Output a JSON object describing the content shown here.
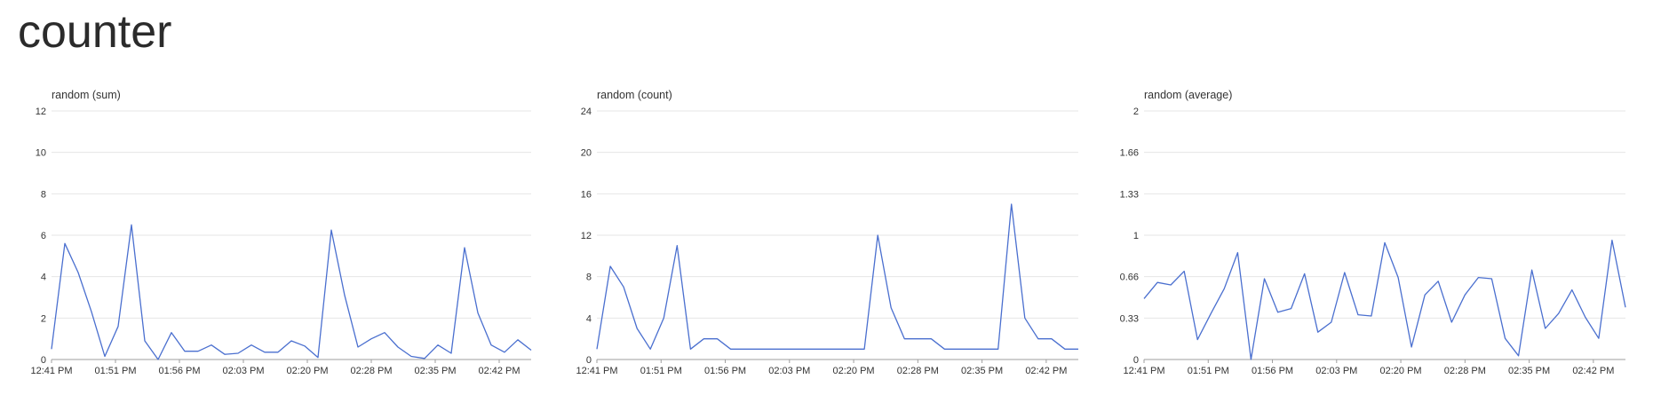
{
  "page": {
    "title": "counter"
  },
  "chart_data": [
    {
      "type": "line",
      "title": "random (sum)",
      "ylim": [
        0,
        12
      ],
      "yticks": [
        "0",
        "2",
        "4",
        "6",
        "8",
        "10",
        "12"
      ],
      "xticks": [
        "12:41 PM",
        "01:51 PM",
        "01:56 PM",
        "02:03 PM",
        "02:20 PM",
        "02:28 PM",
        "02:35 PM",
        "02:42 PM"
      ],
      "color": "#4a6fcf",
      "grid": true,
      "series": [
        {
          "values": [
            0.5,
            5.6,
            4.2,
            2.3,
            0.15,
            1.6,
            6.5,
            0.9,
            0.0,
            1.3,
            0.4,
            0.4,
            0.7,
            0.25,
            0.3,
            0.7,
            0.35,
            0.35,
            0.9,
            0.65,
            0.1,
            6.25,
            3.1,
            0.6,
            1.0,
            1.3,
            0.6,
            0.15,
            0.05,
            0.7,
            0.3,
            5.4,
            2.25,
            0.7,
            0.35,
            0.95,
            0.45
          ]
        }
      ]
    },
    {
      "type": "line",
      "title": "random (count)",
      "ylim": [
        0,
        24
      ],
      "yticks": [
        "0",
        "4",
        "8",
        "12",
        "16",
        "20",
        "24"
      ],
      "xticks": [
        "12:41 PM",
        "01:51 PM",
        "01:56 PM",
        "02:03 PM",
        "02:20 PM",
        "02:28 PM",
        "02:35 PM",
        "02:42 PM"
      ],
      "color": "#4a6fcf",
      "grid": true,
      "series": [
        {
          "values": [
            1,
            9,
            7,
            3,
            1,
            4,
            11,
            1,
            2,
            2,
            1,
            1,
            1,
            1,
            1,
            1,
            1,
            1,
            1,
            1,
            1,
            12,
            5,
            2,
            2,
            2,
            1,
            1,
            1,
            1,
            1,
            15,
            4,
            2,
            2,
            1,
            1
          ]
        }
      ]
    },
    {
      "type": "line",
      "title": "random (average)",
      "ylim": [
        0,
        2
      ],
      "yticks": [
        "0",
        "0.33",
        "0.66",
        "1",
        "1.33",
        "1.66",
        "2"
      ],
      "xticks": [
        "12:41 PM",
        "01:51 PM",
        "01:56 PM",
        "02:03 PM",
        "02:20 PM",
        "02:28 PM",
        "02:35 PM",
        "02:42 PM"
      ],
      "color": "#4a6fcf",
      "grid": true,
      "series": [
        {
          "values": [
            0.49,
            0.62,
            0.6,
            0.71,
            0.16,
            0.37,
            0.57,
            0.86,
            0.0,
            0.65,
            0.38,
            0.41,
            0.69,
            0.22,
            0.3,
            0.7,
            0.36,
            0.35,
            0.94,
            0.66,
            0.1,
            0.52,
            0.63,
            0.3,
            0.52,
            0.66,
            0.65,
            0.17,
            0.03,
            0.72,
            0.25,
            0.37,
            0.56,
            0.34,
            0.17,
            0.96,
            0.42
          ]
        }
      ]
    }
  ]
}
